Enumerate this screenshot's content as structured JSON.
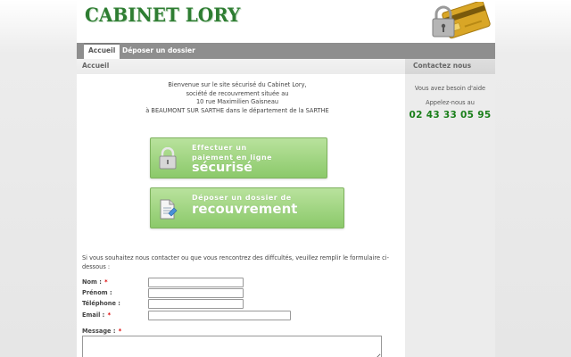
{
  "header": {
    "logo_text": "CABINET LORY",
    "logo_color": "#2e7d32"
  },
  "nav": {
    "items": [
      {
        "label": "Accueil",
        "active": true
      },
      {
        "label": "Déposer un dossier",
        "active": false
      }
    ]
  },
  "main": {
    "title": "Accueil",
    "intro_lines": [
      "Bienvenue sur le site sécurisé du Cabinet Lory,",
      "société de recouvrement située au",
      "10 rue Maximilien Gaisneau",
      "à BEAUMONT SUR SARTHE dans le département de la SARTHE"
    ],
    "cta_pay": {
      "line1": "Effectuer un",
      "line2": "paiement en ligne",
      "big": "sécurisé",
      "icon": "padlock-icon"
    },
    "cta_file": {
      "line1": "Déposer un dossier de",
      "big": "recouvrement",
      "icon": "document-icon"
    },
    "form": {
      "intro": "Si vous souhaitez nous contacter ou que vous rencontrez des diffcultés, veuillez remplir le formulaire ci-dessous :",
      "fields": [
        {
          "label": "Nom :",
          "required": true,
          "value": ""
        },
        {
          "label": "Prénom :",
          "required": false,
          "value": ""
        },
        {
          "label": "Téléphone :",
          "required": false,
          "value": ""
        },
        {
          "label": "Email :",
          "required": true,
          "value": ""
        }
      ],
      "message_label": "Message :",
      "message_required": true,
      "required_marker": "*"
    }
  },
  "sidebar": {
    "title": "Contactez nous",
    "line1": "Vous avez besoin d'aide",
    "line2": "Appelez-nous au",
    "phone": "02 43 33 05 95",
    "phone_color": "#1a7f1a"
  },
  "colors": {
    "cta_green": "#8bc96a",
    "nav_gray": "#8e8e8e",
    "required_red": "#dd0000"
  }
}
